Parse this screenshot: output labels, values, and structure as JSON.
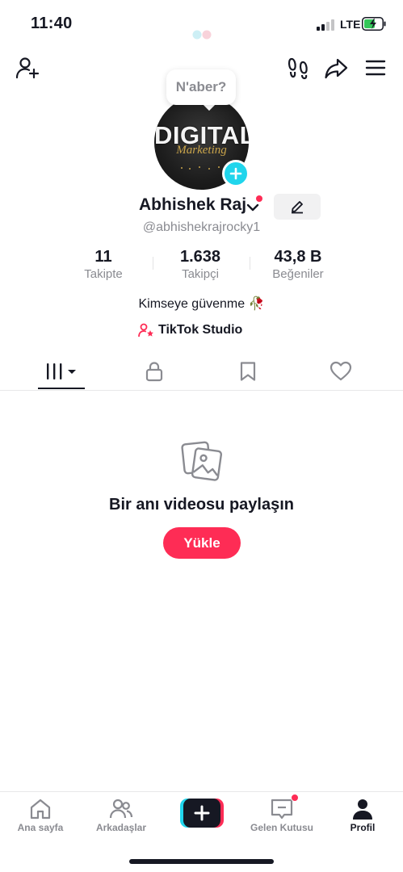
{
  "status_bar": {
    "time": "11:40",
    "network": "LTE"
  },
  "header": {
    "add_friend_icon": "person-add-icon",
    "footprints_icon": "footprints-icon",
    "share_icon": "share-arrow-icon",
    "menu_icon": "hamburger-menu-icon"
  },
  "profile": {
    "bubble_text": "N'aber?",
    "avatar_text": "DIGITAL",
    "avatar_subtext": "Marketing",
    "name": "Abhishek Raj",
    "handle": "@abhishekrajrocky1",
    "stats": [
      {
        "value": "11",
        "label": "Takipte"
      },
      {
        "value": "1.638",
        "label": "Takipçi"
      },
      {
        "value": "43,8 B",
        "label": "Beğeniler"
      }
    ],
    "bio": "Kimseye güvenme 🥀",
    "studio_label": "TikTok Studio"
  },
  "tabs": [
    {
      "name": "videos-tab",
      "icon": "grid-icon",
      "active": true
    },
    {
      "name": "private-tab",
      "icon": "lock-icon",
      "active": false
    },
    {
      "name": "saved-tab",
      "icon": "bookmark-icon",
      "active": false
    },
    {
      "name": "liked-tab",
      "icon": "heart-icon",
      "active": false
    }
  ],
  "empty_state": {
    "title": "Bir anı videosu paylaşın",
    "button_label": "Yükle"
  },
  "bottom_nav": {
    "home": "Ana sayfa",
    "friends": "Arkadaşlar",
    "inbox": "Gelen Kutusu",
    "profile": "Profil"
  },
  "colors": {
    "accent": "#fe2c55",
    "cyan": "#20d5ec",
    "text": "#161823",
    "muted": "#8a8b91"
  }
}
